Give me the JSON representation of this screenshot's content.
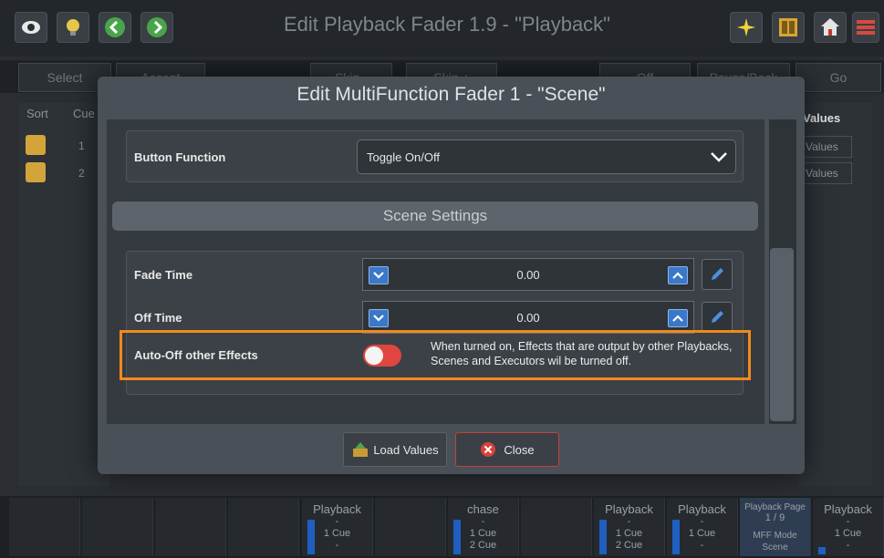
{
  "window": {
    "title": "Edit Playback Fader 1.9 - \"Playback\""
  },
  "toolbar": {
    "left_icons": [
      "eye-icon",
      "bulb-icon",
      "back-arrow-icon",
      "forward-arrow-icon"
    ],
    "right_icons": [
      "sparkle-icon",
      "panel-icon",
      "home-icon",
      "menu-icon"
    ]
  },
  "row2_buttons": [
    "Select",
    "Accept",
    "Skip -",
    "Skip +",
    "Off",
    "Pause/Back",
    "Go"
  ],
  "cue_table": {
    "headers": [
      "Sort",
      "Cue"
    ],
    "rows": [
      {
        "cue": "1"
      },
      {
        "cue": "2"
      }
    ]
  },
  "right_column": {
    "header": "Values",
    "rows": [
      "Values",
      "Values"
    ]
  },
  "dialog": {
    "title": "Edit MultiFunction Fader 1 - \"Scene\"",
    "button_function": {
      "label": "Button Function",
      "value": "Toggle On/Off"
    },
    "section_title": "Scene Settings",
    "fade_time": {
      "label": "Fade Time",
      "value": "0.00"
    },
    "off_time": {
      "label": "Off Time",
      "value": "0.00"
    },
    "auto_off": {
      "label": "Auto-Off other Effects",
      "description": "When turned on, Effects that are output by other Playbacks, Scenes and Executors wil be turned off.",
      "enabled": false
    },
    "load_values": "Load Values",
    "close": "Close"
  },
  "bottom_slots": [
    {
      "title": "Playback",
      "line1": "-",
      "line2": "1 Cue",
      "line3": "-",
      "level": "100%"
    },
    {
      "title": "chase",
      "line1": "-",
      "line2": "1 Cue",
      "line3": "2 Cue",
      "level": "100%"
    },
    {
      "title": "Playback",
      "line1": "-",
      "line2": "1 Cue",
      "line3": "2 Cue",
      "level": "100%"
    },
    {
      "title": "Playback",
      "line1": "-",
      "line2": "1 Cue",
      "line3": "-",
      "level": "100%"
    },
    {
      "title": "Playback Page",
      "line1": "1 / 9",
      "line2": "MFF Mode",
      "line3": "Scene"
    },
    {
      "title": "Playback",
      "line1": "-",
      "line2": "1 Cue",
      "line3": "-",
      "level": "0%"
    }
  ]
}
